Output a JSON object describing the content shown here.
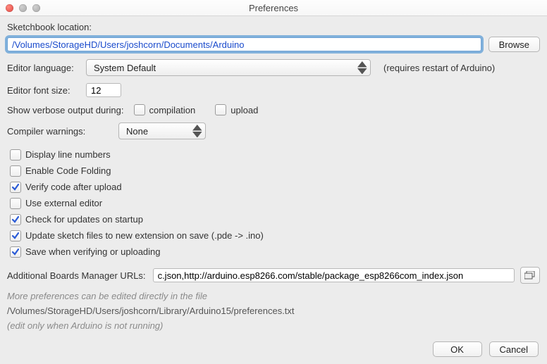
{
  "window": {
    "title": "Preferences"
  },
  "sketchbook": {
    "label": "Sketchbook location:",
    "value": "/Volumes/StorageHD/Users/joshcorn/Documents/Arduino",
    "browse": "Browse"
  },
  "editorLanguage": {
    "label": "Editor language:",
    "value": "System Default",
    "hint": "(requires restart of Arduino)"
  },
  "editorFontSize": {
    "label": "Editor font size:",
    "value": "12"
  },
  "verbose": {
    "label": "Show verbose output during:",
    "compilation": {
      "label": "compilation",
      "checked": false
    },
    "upload": {
      "label": "upload",
      "checked": false
    }
  },
  "compilerWarnings": {
    "label": "Compiler warnings:",
    "value": "None"
  },
  "options": [
    {
      "label": "Display line numbers",
      "checked": false
    },
    {
      "label": "Enable Code Folding",
      "checked": false
    },
    {
      "label": "Verify code after upload",
      "checked": true
    },
    {
      "label": "Use external editor",
      "checked": false
    },
    {
      "label": "Check for updates on startup",
      "checked": true
    },
    {
      "label": "Update sketch files to new extension on save (.pde -> .ino)",
      "checked": true
    },
    {
      "label": "Save when verifying or uploading",
      "checked": true
    }
  ],
  "boardsUrls": {
    "label": "Additional Boards Manager URLs:",
    "value": "c.json,http://arduino.esp8266.com/stable/package_esp8266com_index.json"
  },
  "moreInfo": {
    "line1": "More preferences can be edited directly in the file",
    "path": "/Volumes/StorageHD/Users/joshcorn/Library/Arduino15/preferences.txt",
    "line2": "(edit only when Arduino is not running)"
  },
  "buttons": {
    "ok": "OK",
    "cancel": "Cancel"
  }
}
